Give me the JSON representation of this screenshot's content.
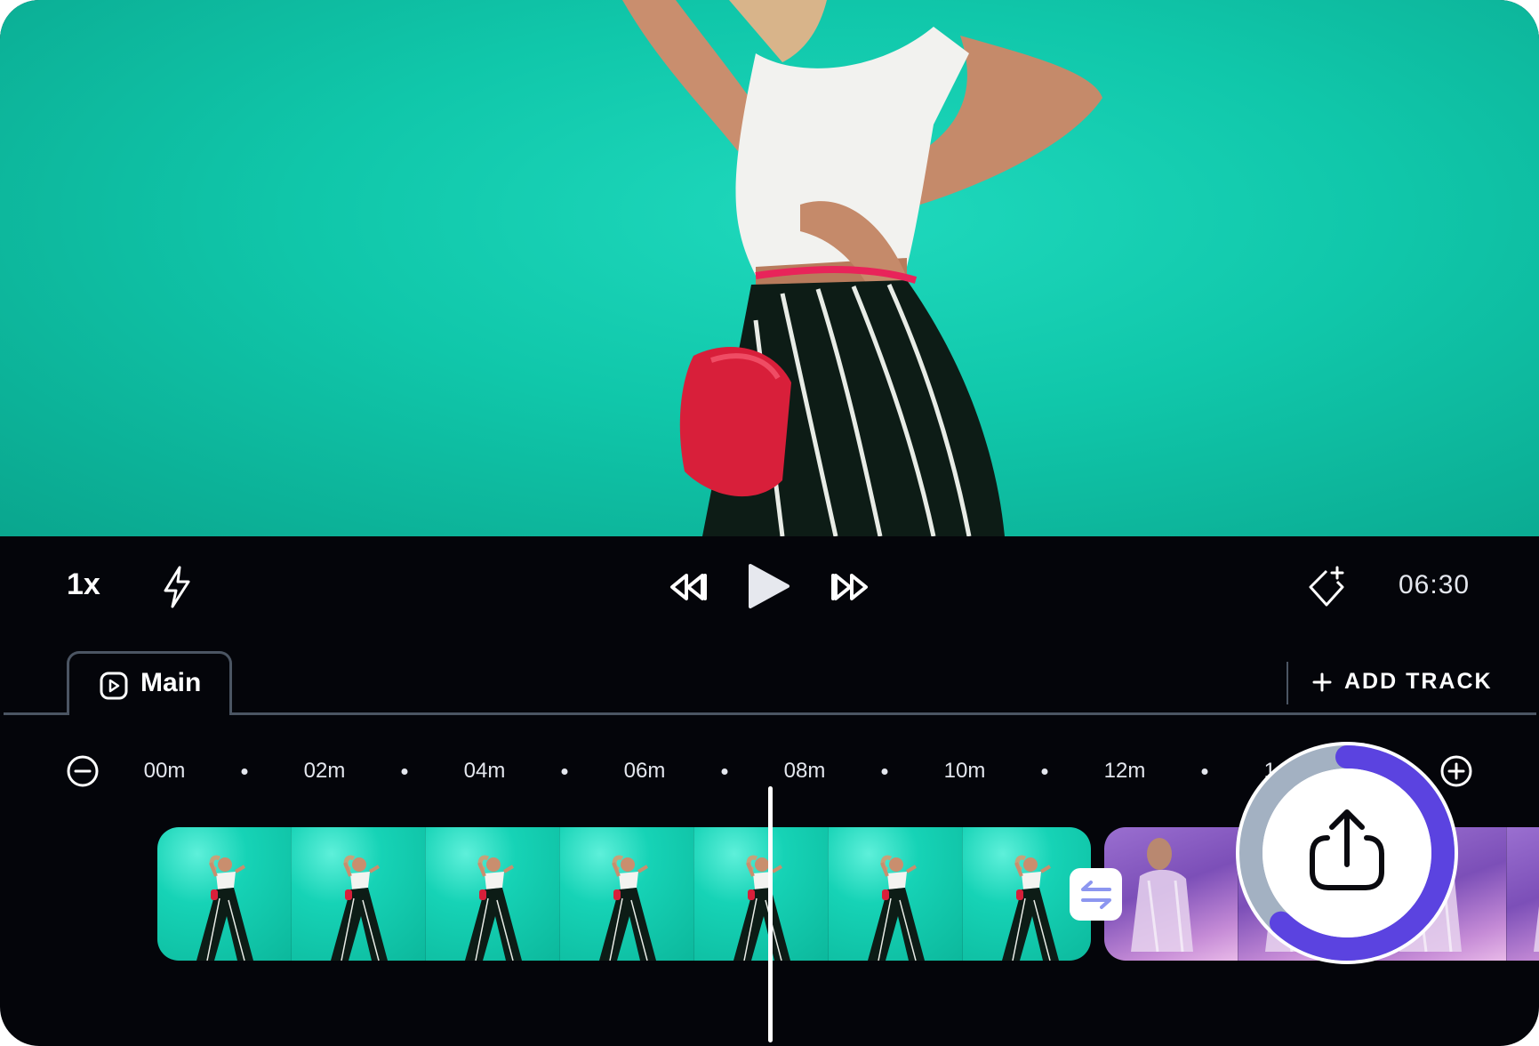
{
  "controls": {
    "speed_label": "1x",
    "time_display": "06:30",
    "icons": [
      "flash-icon",
      "rewind-icon",
      "play-icon",
      "fast-forward-icon",
      "magic-diamond-icon"
    ]
  },
  "tracks": {
    "active_tab": "Main",
    "add_track_label": "ADD TRACK"
  },
  "ruler": {
    "ticks": [
      "00m",
      "02m",
      "04m",
      "06m",
      "08m",
      "10m",
      "12m",
      "14m"
    ]
  },
  "export": {
    "progress": 0.62,
    "ring_color": "#5b43e0",
    "track_color": "#a3b1c2"
  },
  "colors": {
    "accent": "#5b43e0",
    "background": "#04050a",
    "divider": "#4b5563"
  }
}
